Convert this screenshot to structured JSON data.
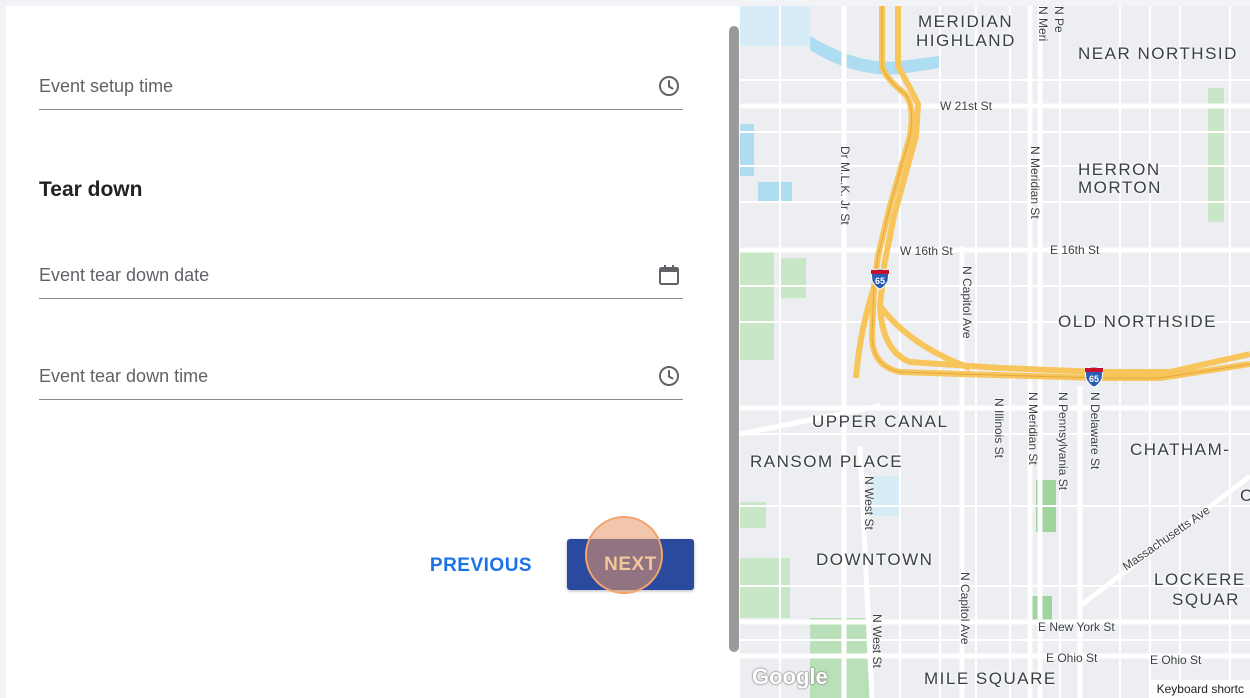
{
  "form": {
    "setup_time_label": "Event setup time",
    "section_title": "Tear down",
    "tear_down_date_label": "Event tear down date",
    "tear_down_time_label": "Event tear down time",
    "previous_label": "PREVIOUS",
    "next_label": "NEXT"
  },
  "icons": {
    "time": "clock-icon",
    "date": "calendar-icon"
  },
  "colors": {
    "primary_button": "#2a4aa0",
    "link": "#1a73e8",
    "highway": "#f7c55c"
  },
  "map": {
    "areas": {
      "meridian": "MERIDIAN",
      "highland": "HIGHLAND",
      "near_northside": "NEAR NORTHSID",
      "herron": "HERRON",
      "morton": "MORTON",
      "old_northside": "OLD NORTHSIDE",
      "upper_canal": "UPPER CANAL",
      "ransom_place": "RANSOM PLACE",
      "chatham": "CHATHAM-",
      "c_partial": "C",
      "downtown": "DOWNTOWN",
      "lockerbie": "LOCKERE",
      "square": "SQUAR",
      "mile_square": "MILE SQUARE"
    },
    "streets": {
      "w21": "W 21st St",
      "w16": "W 16th St",
      "e16": "E 16th St",
      "mlk": "Dr M.L.K. Jr St",
      "n_meridian": "N Meridian St",
      "n_capitol_1": "N Capitol Ave",
      "n_illinois": "N Illinois St",
      "n_meridian_2": "N Meridian St",
      "n_pennsylvania": "N Pennsylvania St",
      "n_delaware": "N Delaware St",
      "n_west_1": "N West St",
      "n_capitol_2": "N Capitol Ave",
      "n_west_2": "N West St",
      "massachusetts": "Massachusetts Ave",
      "e_new_york": "E New York St",
      "e_ohio_1": "E Ohio St",
      "e_ohio_2": "E Ohio St",
      "n_meri_top": "N Meri",
      "n_pe_top": "N Pe"
    },
    "shield_number": "65",
    "google_logo": "Google",
    "keyboard_shortcuts": "Keyboard shortc"
  }
}
